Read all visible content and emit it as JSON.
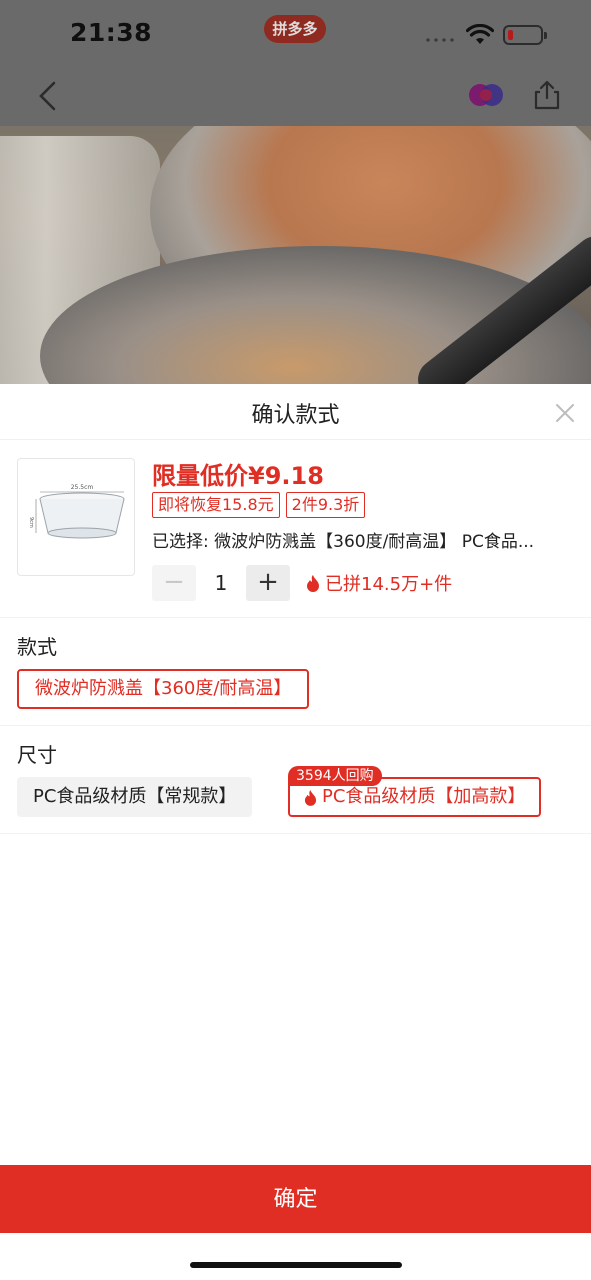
{
  "status_bar": {
    "time": "21:38",
    "app_pill": "拼多多"
  },
  "sheet": {
    "title": "确认款式",
    "price": "限量低价¥9.18",
    "tags": [
      "即将恢复15.8元",
      "2件9.3折"
    ],
    "selected_text": "已选择: 微波炉防溅盖【360度/耐高温】 PC食品...",
    "thumb_dim_width": "25.5cm",
    "thumb_dim_height": "9cm",
    "quantity": "1",
    "sold_text": "已拼14.5万+件",
    "style_section": {
      "title": "款式",
      "option": "微波炉防溅盖【360度/耐高温】"
    },
    "size_section": {
      "title": "尺寸",
      "options": [
        "PC食品级材质【常规款】",
        "PC食品级材质【加高款】"
      ],
      "badge": "3594人回购"
    },
    "confirm_label": "确定"
  },
  "colors": {
    "accent": "#e02e24"
  }
}
